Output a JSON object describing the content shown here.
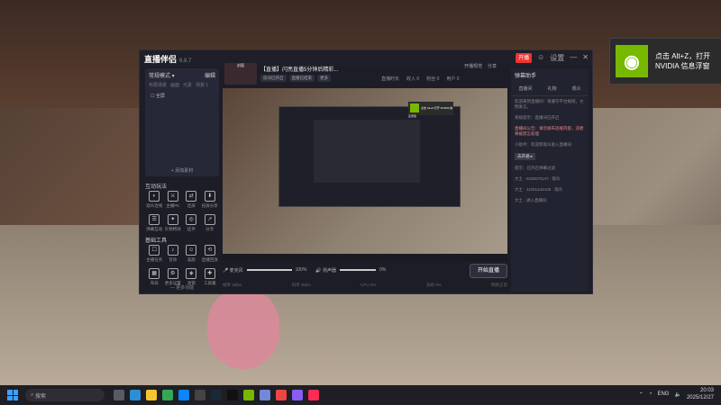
{
  "toast": {
    "text": "点击 Alt+Z，打开 NVIDIA 信息浮窗"
  },
  "window": {
    "brand": "直播伴侣",
    "brand_version": "6.8.7",
    "title_buttons": [
      "开播",
      "☺",
      "设置"
    ],
    "left": {
      "scene_title": "常规模式 ▾",
      "scene_edit": "编辑",
      "scene_tabs": [
        "布局场景",
        "画面",
        "元素",
        "场景 1"
      ],
      "scene_item": "☐ 全屏",
      "add_source": "+ 添加素材",
      "interact_title": "互动玩法",
      "interact_items": [
        "观众连线",
        "主播PK",
        "连屏",
        "投屏分享",
        "弹幕互动",
        "礼物特效",
        "挂件",
        "分享"
      ],
      "tools_title": "基础工具",
      "tools_items": [
        "主播任务",
        "音效",
        "美颜",
        "直播回放",
        "布局",
        "更多设置",
        "滤镜",
        "工具箱"
      ],
      "more": "— 更多功能"
    },
    "info": {
      "thumb_label": "封面",
      "title": "【直播】闪亮直播5分钟后精彩...",
      "chips": [
        "房间已开启",
        "直播已结束",
        "更多"
      ],
      "right_items": [
        "开播规范",
        "分享"
      ],
      "stats": [
        "直播时长",
        "收入 0",
        "粉丝 0",
        "用户 0"
      ]
    },
    "preview_toast": "点击 Alt+Z 打开 NVIDIA 信息浮窗",
    "controls": {
      "mic_label": "🎤 麦克风",
      "mic_pct": "100%",
      "spk_label": "🔊 扬声器",
      "spk_pct": "0%",
      "start": "开始直播"
    },
    "footer": [
      "帧率 30fps",
      "码率 0kb/s",
      "CPU 6%",
      "丢帧 0%",
      "网络正常"
    ],
    "right": {
      "header": "弹幕助手",
      "tabs": [
        "直播间",
        "礼物",
        "观众"
      ],
      "messages": [
        "欢迎来到直播间！请遵守平台规则，文明发言。",
        "系统提示：直播间已开启",
        "小助手：欢迎新观众进入直播间",
        "提示：已开启弹幕过滤"
      ],
      "highlight": "直播间公告：请勿发布违规内容，违者将被禁言处理",
      "button": "去开通 ▸",
      "users": [
        "大土 · ID83570147 · 观众",
        "大土 · 11251444435 · 观众",
        "大土 · 进入直播间"
      ]
    }
  },
  "taskbar": {
    "search": "搜索",
    "tray_lang": "ENG",
    "time": "20:03",
    "date": "2025/12/27"
  },
  "colors": {
    "accent": "#76b900",
    "live": "#e33333",
    "start": "#3aa0ff"
  }
}
